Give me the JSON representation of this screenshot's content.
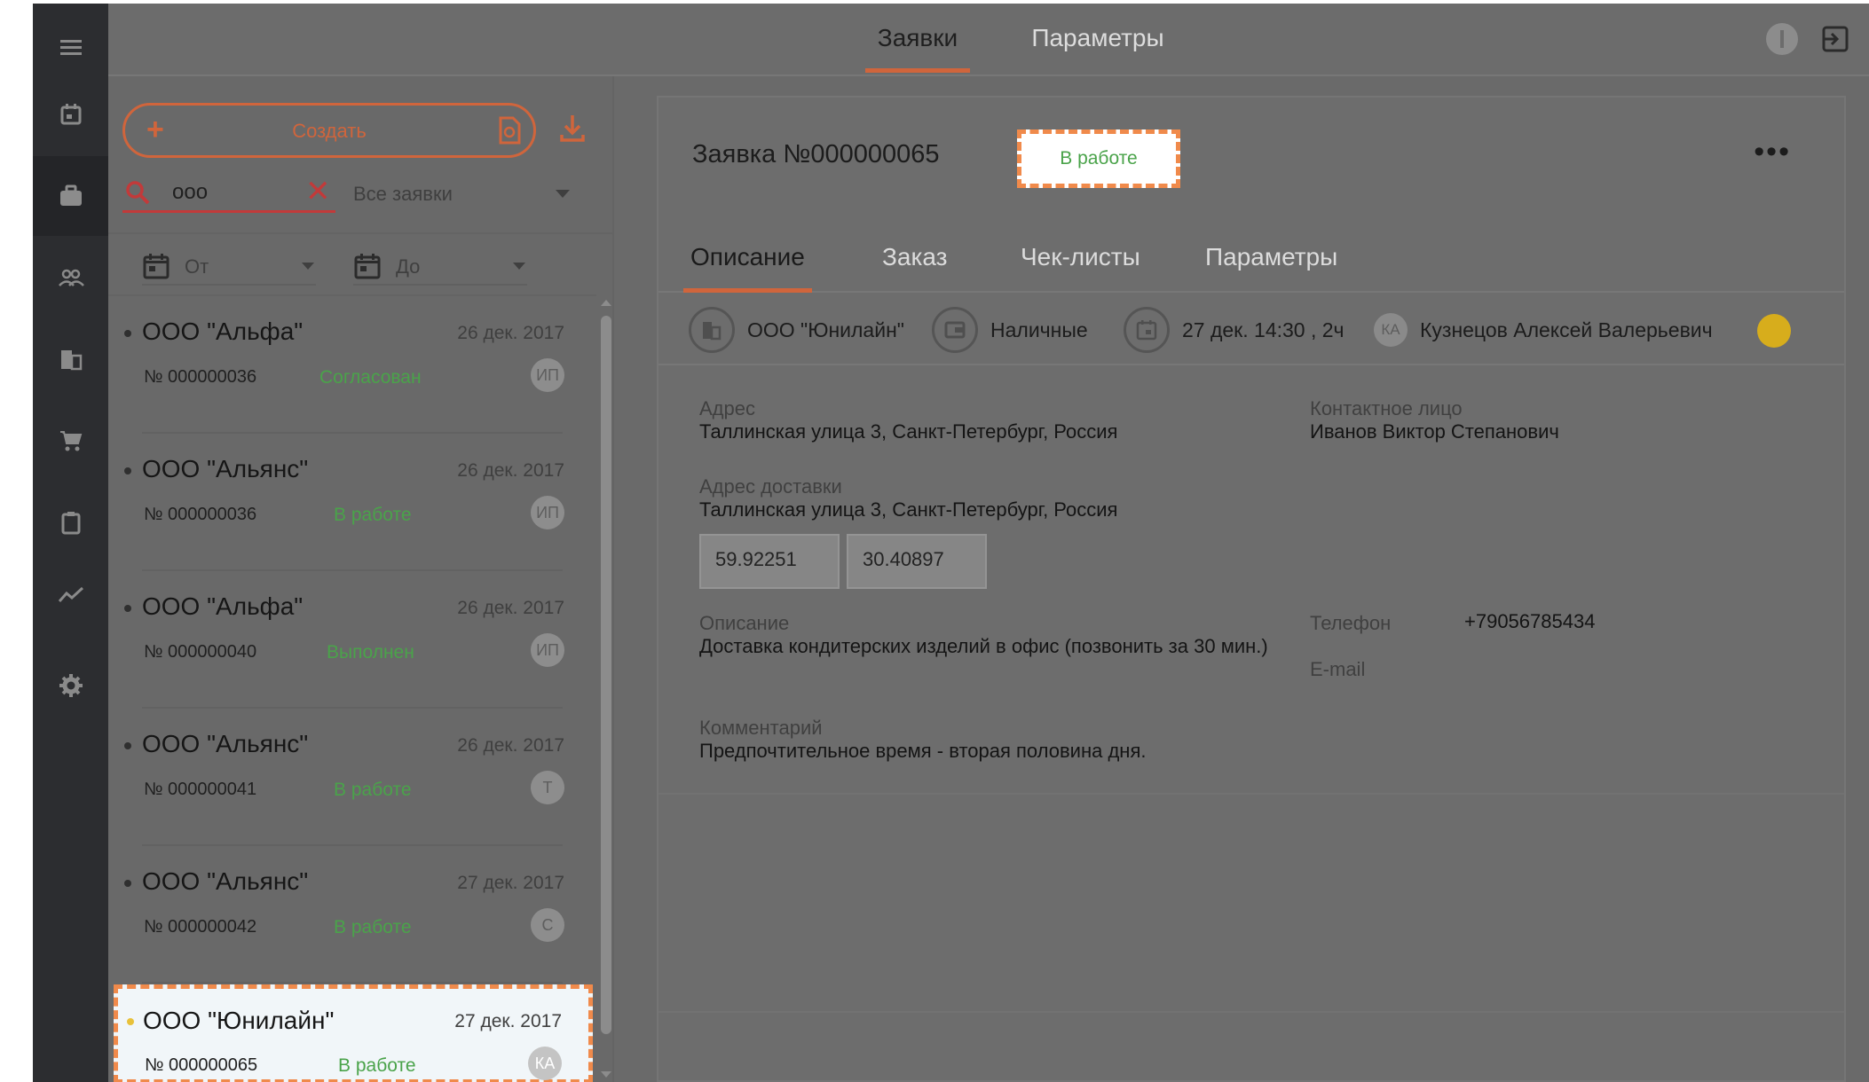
{
  "topbar": {
    "tabs": [
      {
        "label": "Заявки",
        "active": true
      },
      {
        "label": "Параметры",
        "active": false
      }
    ]
  },
  "rail": {
    "items": [
      "menu-icon",
      "calendar-icon",
      "briefcase-icon",
      "users-icon",
      "building-icon",
      "cart-icon",
      "clipboard-icon",
      "chart-icon",
      "gear-icon"
    ],
    "active": "briefcase-icon"
  },
  "list_panel": {
    "create_label": "Создать",
    "search_value": "ооо",
    "filter_value": "Все заявки",
    "date_from": "От",
    "date_to": "До",
    "items": [
      {
        "name": "ООО \"Альфа\"",
        "date": "26 дек. 2017",
        "number": "№ 000000036",
        "status": "Согласован",
        "avatar": "ИП"
      },
      {
        "name": "ООО \"Альянс\"",
        "date": "26 дек. 2017",
        "number": "№ 000000036",
        "status": "В работе",
        "avatar": "ИП"
      },
      {
        "name": "ООО \"Альфа\"",
        "date": "26 дек. 2017",
        "number": "№ 000000040",
        "status": "Выполнен",
        "avatar": "ИП"
      },
      {
        "name": "ООО \"Альянс\"",
        "date": "26 дек. 2017",
        "number": "№ 000000041",
        "status": "В работе",
        "avatar": "Т"
      },
      {
        "name": "ООО \"Альянс\"",
        "date": "27 дек. 2017",
        "number": "№ 000000042",
        "status": "В работе",
        "avatar": "С"
      },
      {
        "name": "ООО \"Юнилайн\"",
        "date": "27 дек. 2017",
        "number": "№ 000000065",
        "status": "В работе",
        "avatar": "КА"
      }
    ]
  },
  "detail": {
    "title": "Заявка №000000065",
    "status": "В работе",
    "more": "•••",
    "tabs": [
      "Описание",
      "Заказ",
      "Чек-листы",
      "Параметры"
    ],
    "meta": {
      "company": "ООО \"Юнилайн\"",
      "payment": "Наличные",
      "datetime": "27 дек. 14:30 , 2ч",
      "executor_initials": "КА",
      "executor": "Кузнецов Алексей Валерьевич"
    },
    "address_label": "Адрес",
    "address": "Таллинская улица 3, Санкт-Петербург, Россия",
    "contact_label": "Контактное лицо",
    "contact": "Иванов Виктор Степанович",
    "delivery_label": "Адрес доставки",
    "delivery": "Таллинская улица 3, Санкт-Петербург, Россия",
    "lat": "59.92251",
    "lon": "30.40897",
    "description_label": "Описание",
    "description": "Доставка кондитерских изделий в офис (позвонить за 30 мин.)",
    "phone_label": "Телефон",
    "phone": "+79056785434",
    "email_label": "E-mail",
    "comment_label": "Комментарий",
    "comment": "Предпочтительное время - вторая половина дня."
  },
  "colors": {
    "accent": "#d0653c",
    "status_green": "#4aa34a",
    "highlight_border": "#f08a4b",
    "executor_dot": "#d7ad1c"
  }
}
